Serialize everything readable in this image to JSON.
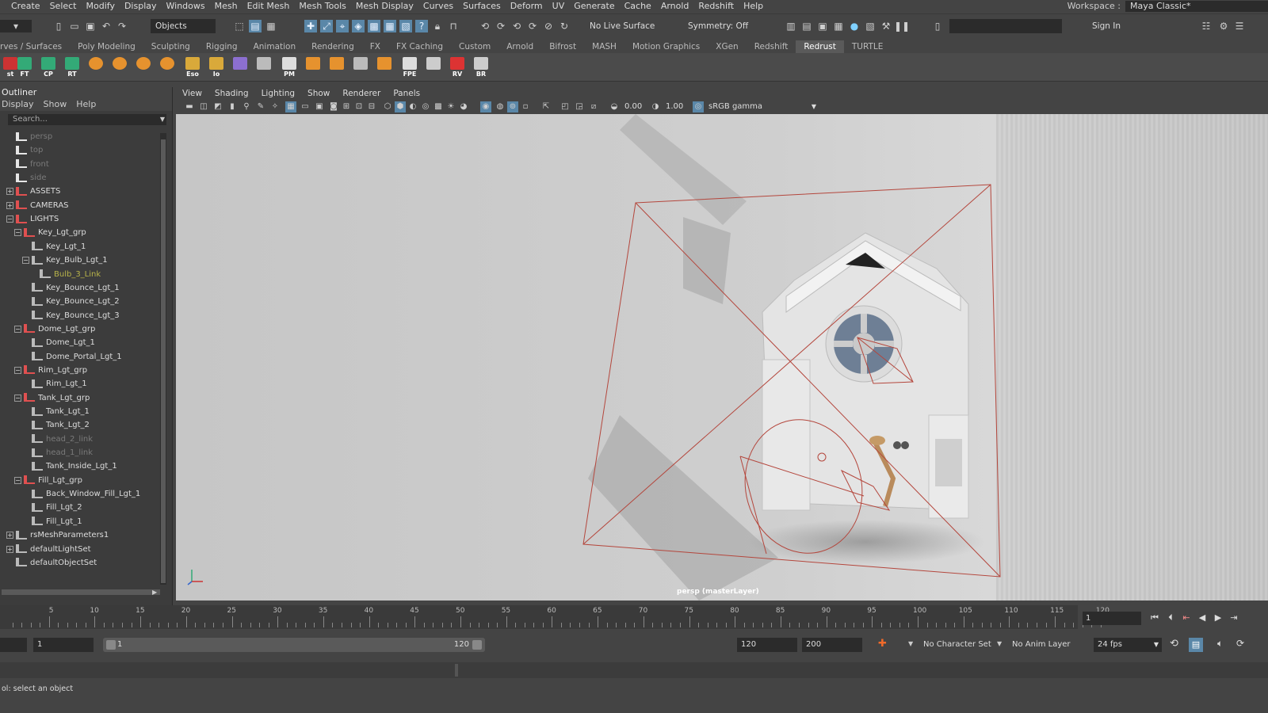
{
  "menubar": [
    "Create",
    "Select",
    "Modify",
    "Display",
    "Windows",
    "Mesh",
    "Edit Mesh",
    "Mesh Tools",
    "Mesh Display",
    "Curves",
    "Surfaces",
    "Deform",
    "UV",
    "Generate",
    "Cache",
    "Arnold",
    "Redshift",
    "Help"
  ],
  "workspace": {
    "label": "Workspace :",
    "value": "Maya Classic*"
  },
  "statusline": {
    "mode": "Objects",
    "live_surface": "No Live Surface",
    "symmetry": "Symmetry: Off",
    "sign_in": "Sign In"
  },
  "shelf_tabs": [
    "rves / Surfaces",
    "Poly Modeling",
    "Sculpting",
    "Rigging",
    "Animation",
    "Rendering",
    "FX",
    "FX Caching",
    "Custom",
    "Arnold",
    "Bifrost",
    "MASH",
    "Motion Graphics",
    "XGen",
    "Redshift",
    "Redrust",
    "TURTLE"
  ],
  "shelf_active": "Redrust",
  "shelf_icons": [
    "st",
    "FT",
    "CP",
    "RT",
    "",
    "",
    "",
    "",
    "Eso",
    "Io",
    "",
    "",
    "PM",
    "",
    "",
    "",
    "",
    "FPE",
    "",
    "RV",
    "BR"
  ],
  "outliner": {
    "title": "Outliner",
    "menu": [
      "Display",
      "Show",
      "Help"
    ],
    "search_placeholder": "Search...",
    "rows": [
      {
        "label": "persp",
        "style": "dim"
      },
      {
        "label": "top",
        "style": "dim"
      },
      {
        "label": "front",
        "style": "dim"
      },
      {
        "label": "side",
        "style": "dim"
      },
      {
        "label": "ASSETS",
        "style": "normal"
      },
      {
        "label": "CAMERAS",
        "style": "normal"
      },
      {
        "label": "LIGHTS",
        "style": "normal"
      },
      {
        "label": "Key_Lgt_grp",
        "style": "normal"
      },
      {
        "label": "Key_Lgt_1",
        "style": "normal"
      },
      {
        "label": "Key_Bulb_Lgt_1",
        "style": "normal"
      },
      {
        "label": "Bulb_3_Link",
        "style": "yellow"
      },
      {
        "label": "Key_Bounce_Lgt_1",
        "style": "normal"
      },
      {
        "label": "Key_Bounce_Lgt_2",
        "style": "normal"
      },
      {
        "label": "Key_Bounce_Lgt_3",
        "style": "normal"
      },
      {
        "label": "Dome_Lgt_grp",
        "style": "normal"
      },
      {
        "label": "Dome_Lgt_1",
        "style": "normal"
      },
      {
        "label": "Dome_Portal_Lgt_1",
        "style": "normal"
      },
      {
        "label": "Rim_Lgt_grp",
        "style": "normal"
      },
      {
        "label": "Rim_Lgt_1",
        "style": "normal"
      },
      {
        "label": "Tank_Lgt_grp",
        "style": "normal"
      },
      {
        "label": "Tank_Lgt_1",
        "style": "normal"
      },
      {
        "label": "Tank_Lgt_2",
        "style": "normal"
      },
      {
        "label": "head_2_link",
        "style": "dim"
      },
      {
        "label": "head_1_link",
        "style": "dim"
      },
      {
        "label": "Tank_Inside_Lgt_1",
        "style": "normal"
      },
      {
        "label": "Fill_Lgt_grp",
        "style": "normal"
      },
      {
        "label": "Back_Window_Fill_Lgt_1",
        "style": "normal"
      },
      {
        "label": "Fill_Lgt_2",
        "style": "normal"
      },
      {
        "label": "Fill_Lgt_1",
        "style": "normal"
      },
      {
        "label": "rsMeshParameters1",
        "style": "normal"
      },
      {
        "label": "defaultLightSet",
        "style": "normal"
      },
      {
        "label": "defaultObjectSet",
        "style": "normal"
      }
    ]
  },
  "viewport": {
    "menu": [
      "View",
      "Shading",
      "Lighting",
      "Show",
      "Renderer",
      "Panels"
    ],
    "exposure": "0.00",
    "gamma": "1.00",
    "colorspace": "sRGB gamma",
    "camera_label": "persp (masterLayer)"
  },
  "timeline": {
    "ticks": [
      "5",
      "10",
      "15",
      "20",
      "25",
      "30",
      "35",
      "40",
      "45",
      "50",
      "55",
      "60",
      "65",
      "70",
      "75",
      "80",
      "85",
      "90",
      "95",
      "100",
      "105",
      "110",
      "115",
      "120"
    ],
    "current_frame": "1"
  },
  "range": {
    "start": "1",
    "inner_start": "1",
    "inner_end": "120",
    "end": "120",
    "max": "200",
    "character_set": "No Character Set",
    "anim_layer": "No Anim Layer",
    "fps": "24 fps"
  },
  "helpline": "ol: select an object",
  "colors": {
    "accent": "#5a87a8",
    "light_wire": "#b4463c"
  }
}
